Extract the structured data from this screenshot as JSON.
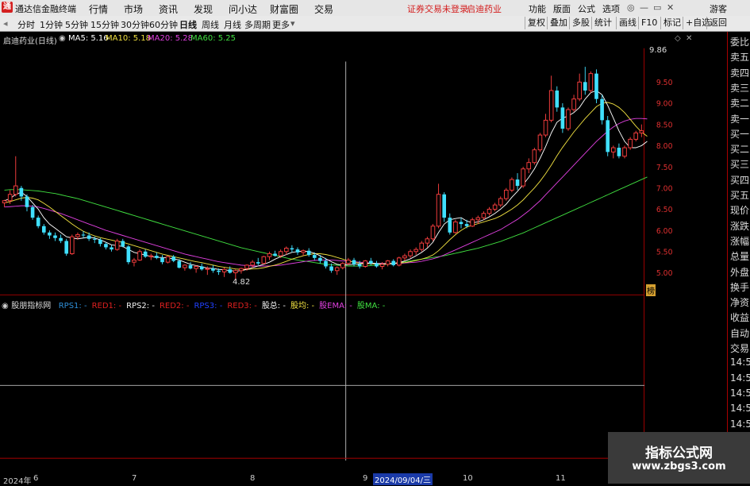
{
  "app": {
    "title": "通达信金融终端"
  },
  "menu": [
    "行情",
    "市场",
    "资讯",
    "发现",
    "问小达",
    "财富圈",
    "交易"
  ],
  "status": {
    "warning": "证券交易未登录",
    "stock": "启迪药业"
  },
  "toolbar": {
    "gongneng": "功能",
    "banmian": "版面",
    "gongshi": "公式",
    "xuanxiang": "选项",
    "user": "游客"
  },
  "periods": [
    "分时",
    "1分钟",
    "5分钟",
    "15分钟",
    "30分钟",
    "60分钟",
    "日线",
    "周线",
    "月线",
    "多周期",
    "更多"
  ],
  "actions": [
    "复权",
    "叠加",
    "多股",
    "统计",
    "画线",
    "F10",
    "标记",
    "+自选",
    "返回"
  ],
  "main": {
    "stock_title": "启迪药业(日线)",
    "ma5": "MA5: 5.16",
    "ma10": "MA10: 5.18",
    "ma20": "MA20: 5.28",
    "ma60": "MA60: 5.25",
    "high_label": "9.86",
    "low_label": "4.82",
    "bang": "榜"
  },
  "price_axis": [
    "9.50",
    "9.00",
    "8.50",
    "8.00",
    "7.50",
    "7.00",
    "6.50",
    "6.00",
    "5.50",
    "5.00"
  ],
  "indicator": {
    "name": "股朋指标网",
    "items": [
      {
        "text": "RPS1: -",
        "color": "#2e8fd8"
      },
      {
        "text": "RED1: -",
        "color": "#e02020"
      },
      {
        "text": "RPS2: -",
        "color": "#f0f0f0"
      },
      {
        "text": "RED2: -",
        "color": "#e02020"
      },
      {
        "text": "RPS3: -",
        "color": "#2040ff"
      },
      {
        "text": "RED3: -",
        "color": "#e02020"
      },
      {
        "text": "股总: -",
        "color": "#f0f0f0"
      },
      {
        "text": "股均: -",
        "color": "#f0e040"
      },
      {
        "text": "股EMA: -",
        "color": "#e040e0"
      },
      {
        "text": "股MA: -",
        "color": "#40e040"
      }
    ]
  },
  "date_axis": {
    "year": "2024年",
    "months": [
      "6",
      "7",
      "8",
      "9",
      "10",
      "11"
    ],
    "cursor": "2024/09/04/三"
  },
  "right_panel": [
    "委比",
    "卖五",
    "卖四",
    "卖三",
    "卖二",
    "卖一",
    "买一",
    "买二",
    "买三",
    "买四",
    "买五",
    "现价",
    "涨跌",
    "涨幅",
    "总量",
    "外盘",
    "换手",
    "净资",
    "收益",
    "自动",
    "交易",
    "14:55",
    "14:56",
    "14:56",
    "14:56",
    "14:56",
    "14:56"
  ],
  "watermark": {
    "title": "指标公式网",
    "url": "www.zbgs3.com"
  },
  "colors": {
    "up": "#ff4040",
    "down": "#40e0ff",
    "ma5": "#ffffff",
    "ma10": "#f0e040",
    "ma20": "#e040e0",
    "ma60": "#40e040"
  },
  "chart_data": {
    "type": "candlestick",
    "price_range": [
      4.6,
      9.95
    ],
    "candles": [
      [
        6.65,
        6.72,
        6.55,
        6.7
      ],
      [
        6.7,
        6.95,
        6.62,
        6.85
      ],
      [
        6.85,
        7.75,
        6.8,
        7.05
      ],
      [
        7.0,
        7.05,
        6.7,
        6.8
      ],
      [
        6.8,
        6.85,
        6.45,
        6.55
      ],
      [
        6.55,
        6.6,
        6.25,
        6.3
      ],
      [
        6.3,
        6.35,
        6.05,
        6.1
      ],
      [
        6.1,
        6.15,
        5.9,
        5.95
      ],
      [
        5.95,
        6.0,
        5.8,
        5.88
      ],
      [
        5.88,
        5.95,
        5.75,
        5.82
      ],
      [
        5.82,
        5.9,
        5.7,
        5.75
      ],
      [
        5.75,
        5.8,
        5.4,
        5.45
      ],
      [
        5.45,
        5.9,
        5.42,
        5.85
      ],
      [
        5.85,
        5.95,
        5.78,
        5.9
      ],
      [
        5.9,
        5.98,
        5.82,
        5.88
      ],
      [
        5.88,
        5.95,
        5.75,
        5.8
      ],
      [
        5.8,
        5.85,
        5.7,
        5.78
      ],
      [
        5.78,
        5.82,
        5.62,
        5.68
      ],
      [
        5.68,
        5.72,
        5.55,
        5.6
      ],
      [
        5.6,
        5.65,
        5.5,
        5.55
      ],
      [
        5.55,
        5.8,
        5.52,
        5.75
      ],
      [
        5.75,
        5.8,
        5.6,
        5.62
      ],
      [
        5.62,
        5.65,
        5.2,
        5.25
      ],
      [
        5.25,
        5.35,
        5.15,
        5.3
      ],
      [
        5.3,
        5.55,
        5.28,
        5.5
      ],
      [
        5.5,
        5.55,
        5.35,
        5.38
      ],
      [
        5.38,
        5.45,
        5.3,
        5.4
      ],
      [
        5.4,
        5.48,
        5.32,
        5.35
      ],
      [
        5.35,
        5.42,
        5.2,
        5.25
      ],
      [
        5.25,
        5.4,
        5.22,
        5.38
      ],
      [
        5.38,
        5.42,
        5.25,
        5.28
      ],
      [
        5.28,
        5.32,
        5.1,
        5.12
      ],
      [
        5.12,
        5.2,
        5.05,
        5.18
      ],
      [
        5.18,
        5.25,
        5.08,
        5.1
      ],
      [
        5.1,
        5.18,
        5.0,
        5.15
      ],
      [
        5.15,
        5.22,
        5.05,
        5.08
      ],
      [
        5.08,
        5.15,
        4.95,
        5.1
      ],
      [
        5.1,
        5.18,
        5.0,
        5.05
      ],
      [
        5.05,
        5.1,
        4.95,
        5.02
      ],
      [
        5.02,
        5.12,
        4.9,
        5.08
      ],
      [
        5.08,
        5.15,
        4.98,
        5.0
      ],
      [
        5.0,
        5.08,
        4.82,
        5.05
      ],
      [
        5.05,
        5.12,
        4.98,
        5.1
      ],
      [
        5.1,
        5.2,
        5.05,
        5.18
      ],
      [
        5.18,
        5.3,
        5.12,
        5.25
      ],
      [
        5.25,
        5.35,
        5.18,
        5.22
      ],
      [
        5.22,
        5.4,
        5.2,
        5.38
      ],
      [
        5.38,
        5.5,
        5.3,
        5.45
      ],
      [
        5.45,
        5.52,
        5.38,
        5.4
      ],
      [
        5.4,
        5.55,
        5.35,
        5.5
      ],
      [
        5.5,
        5.62,
        5.42,
        5.58
      ],
      [
        5.58,
        5.65,
        5.48,
        5.55
      ],
      [
        5.55,
        5.6,
        5.42,
        5.48
      ],
      [
        5.48,
        5.55,
        5.4,
        5.52
      ],
      [
        5.52,
        5.58,
        5.38,
        5.42
      ],
      [
        5.42,
        5.48,
        5.3,
        5.35
      ],
      [
        5.35,
        5.42,
        5.22,
        5.28
      ],
      [
        5.28,
        5.35,
        5.1,
        5.15
      ],
      [
        5.15,
        5.22,
        5.0,
        5.05
      ],
      [
        5.05,
        5.15,
        4.95,
        5.12
      ],
      [
        5.12,
        5.25,
        5.08,
        5.22
      ],
      [
        5.22,
        5.35,
        5.18,
        5.3
      ],
      [
        5.3,
        5.35,
        5.15,
        5.2
      ],
      [
        5.2,
        5.28,
        5.1,
        5.15
      ],
      [
        5.15,
        5.3,
        5.12,
        5.28
      ],
      [
        5.28,
        5.35,
        5.18,
        5.22
      ],
      [
        5.22,
        5.28,
        5.12,
        5.15
      ],
      [
        5.15,
        5.25,
        5.08,
        5.2
      ],
      [
        5.2,
        5.3,
        5.15,
        5.28
      ],
      [
        5.28,
        5.32,
        5.15,
        5.18
      ],
      [
        5.18,
        5.38,
        5.15,
        5.35
      ],
      [
        5.35,
        5.45,
        5.28,
        5.4
      ],
      [
        5.4,
        5.55,
        5.35,
        5.5
      ],
      [
        5.5,
        5.6,
        5.42,
        5.55
      ],
      [
        5.55,
        5.75,
        5.5,
        5.7
      ],
      [
        5.7,
        5.85,
        5.6,
        5.8
      ],
      [
        5.8,
        6.15,
        5.75,
        6.1
      ],
      [
        6.1,
        7.1,
        6.05,
        6.85
      ],
      [
        6.85,
        6.9,
        6.2,
        6.3
      ],
      [
        6.3,
        6.4,
        5.9,
        5.95
      ],
      [
        5.95,
        6.25,
        5.92,
        6.2
      ],
      [
        6.2,
        6.3,
        6.05,
        6.15
      ],
      [
        6.15,
        6.25,
        6.05,
        6.1
      ],
      [
        6.1,
        6.3,
        6.08,
        6.25
      ],
      [
        6.25,
        6.35,
        6.15,
        6.3
      ],
      [
        6.3,
        6.45,
        6.25,
        6.4
      ],
      [
        6.4,
        6.55,
        6.35,
        6.5
      ],
      [
        6.5,
        6.65,
        6.45,
        6.6
      ],
      [
        6.6,
        6.8,
        6.55,
        6.75
      ],
      [
        6.75,
        7.0,
        6.7,
        6.95
      ],
      [
        6.95,
        7.25,
        6.9,
        7.2
      ],
      [
        7.2,
        7.35,
        6.95,
        7.05
      ],
      [
        7.05,
        7.5,
        7.0,
        7.45
      ],
      [
        7.45,
        7.7,
        7.35,
        7.6
      ],
      [
        7.6,
        7.95,
        7.55,
        7.9
      ],
      [
        7.9,
        8.3,
        7.85,
        8.25
      ],
      [
        8.25,
        8.75,
        8.2,
        8.6
      ],
      [
        8.6,
        9.65,
        8.55,
        9.3
      ],
      [
        9.3,
        9.4,
        8.8,
        8.9
      ],
      [
        8.9,
        9.0,
        8.3,
        8.4
      ],
      [
        8.4,
        8.9,
        8.35,
        8.85
      ],
      [
        8.85,
        9.2,
        8.8,
        9.1
      ],
      [
        9.1,
        9.7,
        9.05,
        9.5
      ],
      [
        9.5,
        9.86,
        9.2,
        9.3
      ],
      [
        9.3,
        9.75,
        9.25,
        9.7
      ],
      [
        9.7,
        9.8,
        9.0,
        9.1
      ],
      [
        9.1,
        9.2,
        8.5,
        8.6
      ],
      [
        8.6,
        8.7,
        7.75,
        7.85
      ],
      [
        7.85,
        8.0,
        7.7,
        7.95
      ],
      [
        7.95,
        8.05,
        7.7,
        7.75
      ],
      [
        7.75,
        8.0,
        7.7,
        7.95
      ],
      [
        7.95,
        8.2,
        7.9,
        8.15
      ],
      [
        8.15,
        8.35,
        8.1,
        8.3
      ],
      [
        8.3,
        8.5,
        8.2,
        8.35
      ]
    ],
    "ma5": [
      6.7,
      6.75,
      6.85,
      6.9,
      6.8,
      6.65,
      6.5,
      6.3,
      6.15,
      6.05,
      5.95,
      5.85,
      5.82,
      5.8,
      5.82,
      5.84,
      5.82,
      5.78,
      5.72,
      5.66,
      5.64,
      5.62,
      5.55,
      5.48,
      5.45,
      5.42,
      5.38,
      5.36,
      5.36,
      5.35,
      5.33,
      5.3,
      5.25,
      5.2,
      5.17,
      5.14,
      5.11,
      5.1,
      5.08,
      5.07,
      5.05,
      5.04,
      5.05,
      5.08,
      5.12,
      5.16,
      5.2,
      5.25,
      5.32,
      5.38,
      5.43,
      5.48,
      5.5,
      5.51,
      5.5,
      5.46,
      5.4,
      5.33,
      5.26,
      5.2,
      5.18,
      5.19,
      5.2,
      5.21,
      5.22,
      5.23,
      5.22,
      5.21,
      5.21,
      5.22,
      5.24,
      5.28,
      5.33,
      5.4,
      5.48,
      5.58,
      5.72,
      5.95,
      6.15,
      6.25,
      6.28,
      6.3,
      6.22,
      6.18,
      6.2,
      6.25,
      6.32,
      6.4,
      6.5,
      6.62,
      6.78,
      6.92,
      7.08,
      7.25,
      7.45,
      7.7,
      7.98,
      8.3,
      8.55,
      8.65,
      8.7,
      8.78,
      8.9,
      9.1,
      9.25,
      9.3,
      9.2,
      8.95,
      8.65,
      8.35,
      8.1,
      7.95,
      7.95,
      8.0,
      8.1
    ],
    "ma10": [
      6.65,
      6.68,
      6.72,
      6.76,
      6.78,
      6.76,
      6.72,
      6.64,
      6.55,
      6.45,
      6.35,
      6.25,
      6.15,
      6.06,
      5.98,
      5.92,
      5.87,
      5.83,
      5.8,
      5.77,
      5.74,
      5.72,
      5.68,
      5.64,
      5.6,
      5.56,
      5.52,
      5.48,
      5.44,
      5.41,
      5.38,
      5.35,
      5.32,
      5.29,
      5.26,
      5.24,
      5.21,
      5.18,
      5.15,
      5.13,
      5.11,
      5.09,
      5.08,
      5.08,
      5.09,
      5.1,
      5.12,
      5.15,
      5.18,
      5.22,
      5.27,
      5.32,
      5.36,
      5.4,
      5.43,
      5.45,
      5.45,
      5.43,
      5.4,
      5.36,
      5.32,
      5.28,
      5.25,
      5.23,
      5.22,
      5.21,
      5.21,
      5.21,
      5.22,
      5.22,
      5.23,
      5.24,
      5.26,
      5.29,
      5.32,
      5.36,
      5.42,
      5.52,
      5.65,
      5.78,
      5.9,
      6.0,
      6.08,
      6.12,
      6.16,
      6.2,
      6.24,
      6.28,
      6.34,
      6.42,
      6.5,
      6.6,
      6.72,
      6.86,
      7.0,
      7.16,
      7.34,
      7.54,
      7.76,
      7.96,
      8.14,
      8.32,
      8.48,
      8.64,
      8.78,
      8.92,
      9.0,
      9.02,
      8.98,
      8.9,
      8.78,
      8.62,
      8.46,
      8.32,
      8.22
    ],
    "ma20": [
      6.55,
      6.56,
      6.57,
      6.58,
      6.58,
      6.57,
      6.55,
      6.52,
      6.48,
      6.44,
      6.4,
      6.35,
      6.3,
      6.25,
      6.2,
      6.15,
      6.1,
      6.05,
      6.0,
      5.96,
      5.92,
      5.88,
      5.84,
      5.8,
      5.76,
      5.72,
      5.68,
      5.64,
      5.6,
      5.56,
      5.52,
      5.48,
      5.44,
      5.41,
      5.38,
      5.35,
      5.32,
      5.29,
      5.26,
      5.24,
      5.22,
      5.2,
      5.18,
      5.17,
      5.16,
      5.16,
      5.16,
      5.16,
      5.17,
      5.18,
      5.2,
      5.22,
      5.24,
      5.26,
      5.28,
      5.29,
      5.3,
      5.3,
      5.3,
      5.29,
      5.28,
      5.27,
      5.26,
      5.25,
      5.24,
      5.23,
      5.22,
      5.22,
      5.22,
      5.22,
      5.22,
      5.23,
      5.24,
      5.25,
      5.27,
      5.3,
      5.33,
      5.37,
      5.42,
      5.48,
      5.54,
      5.6,
      5.66,
      5.72,
      5.78,
      5.84,
      5.9,
      5.96,
      6.02,
      6.1,
      6.18,
      6.26,
      6.36,
      6.46,
      6.58,
      6.7,
      6.84,
      6.98,
      7.12,
      7.26,
      7.4,
      7.54,
      7.68,
      7.82,
      7.96,
      8.1,
      8.22,
      8.34,
      8.44,
      8.52,
      8.58,
      8.62,
      8.64,
      8.64,
      8.63
    ],
    "ma60": [
      6.95,
      6.96,
      6.96,
      6.96,
      6.95,
      6.94,
      6.93,
      6.91,
      6.89,
      6.87,
      6.84,
      6.81,
      6.78,
      6.75,
      6.71,
      6.67,
      6.63,
      6.59,
      6.55,
      6.51,
      6.47,
      6.43,
      6.39,
      6.35,
      6.31,
      6.27,
      6.23,
      6.19,
      6.15,
      6.11,
      6.07,
      6.03,
      5.99,
      5.95,
      5.91,
      5.87,
      5.83,
      5.79,
      5.75,
      5.71,
      5.67,
      5.63,
      5.59,
      5.56,
      5.53,
      5.5,
      5.47,
      5.44,
      5.41,
      5.38,
      5.35,
      5.32,
      5.3,
      5.28,
      5.26,
      5.24,
      5.22,
      5.2,
      5.19,
      5.18,
      5.17,
      5.16,
      5.16,
      5.16,
      5.16,
      5.17,
      5.18,
      5.19,
      5.2,
      5.22,
      5.24,
      5.26,
      5.28,
      5.3,
      5.32,
      5.34,
      5.36,
      5.38,
      5.4,
      5.43,
      5.46,
      5.49,
      5.52,
      5.55,
      5.58,
      5.62,
      5.66,
      5.7,
      5.74,
      5.79,
      5.84,
      5.89,
      5.94,
      6.0,
      6.06,
      6.12,
      6.18,
      6.24,
      6.3,
      6.36,
      6.42,
      6.48,
      6.54,
      6.6,
      6.66,
      6.72,
      6.78,
      6.84,
      6.9,
      6.96,
      7.02,
      7.08,
      7.14,
      7.2,
      7.26
    ]
  }
}
